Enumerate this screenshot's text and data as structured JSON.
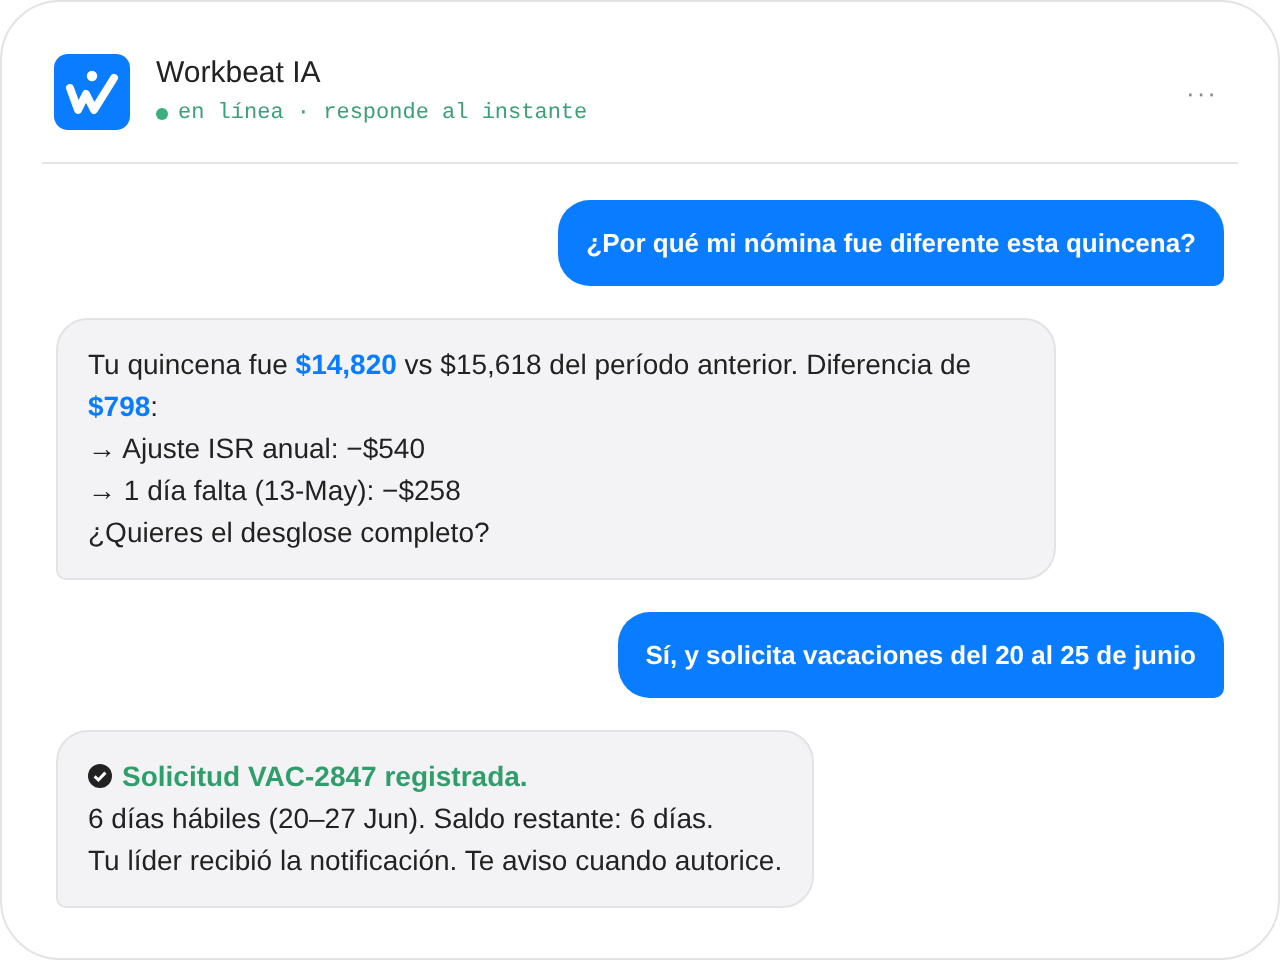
{
  "header": {
    "title": "Workbeat IA",
    "online": true,
    "status": "en línea · responde al instante",
    "menu": "···"
  },
  "messages": [
    {
      "kind": "user",
      "text": "¿Por qué mi nómina fue diferente esta quincena?"
    },
    {
      "kind": "bot",
      "lines": [
        "Tu quincena fue **$14,820** vs $15,618 del período anterior. Diferencia de **$798**:",
        "→ Ajuste ISR anual: −$540",
        "→ 1 día falta (13-May): −$258",
        "¿Quieres el desglose completo?"
      ]
    },
    {
      "kind": "user",
      "text": "Sí, y solicita vacaciones del 20 al 25 de junio"
    },
    {
      "kind": "bot",
      "heading": "Solicitud VAC-2847 registrada.",
      "lines": [
        "6 días hábiles (20–27 Jun). Saldo restante: 6 días.",
        "Tu líder recibió la notificación. Te aviso cuando autorice."
      ]
    }
  ]
}
